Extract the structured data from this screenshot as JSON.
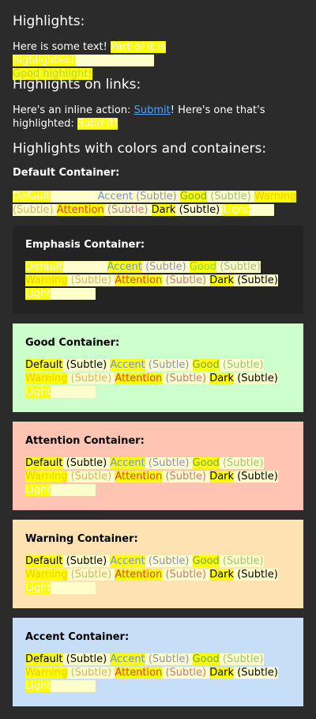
{
  "sections": {
    "highlights_title": "Highlights:",
    "highlights_text_plain": "Here is some text! ",
    "highlights_text_hl": "Part of it is highlighted!",
    "highlights_text_space": " ",
    "highlights_text_hl2": "Good highlight!",
    "links_title": "Highlights on links:",
    "links_text_plain": "Here's an inline action: ",
    "links_action1": "Submit",
    "links_text_mid": "! Here's one that's highlighted: ",
    "links_action2": "Submit!",
    "colors_title": "Highlights with colors and containers:"
  },
  "labels": {
    "default": "Default",
    "subtle": "(Subtle)",
    "accent": "Accent",
    "good": "Good",
    "warning": "Warning",
    "attention": "Attention",
    "dark": "Dark",
    "light": "Light"
  },
  "containers": [
    {
      "title": "Default Container:",
      "bg": "#2b2b2b"
    },
    {
      "title": "Emphasis Container:",
      "bg": "#232323"
    },
    {
      "title": "Good Container:",
      "bg": "#ccffcc"
    },
    {
      "title": "Attention Container:",
      "bg": "#ffc5b2"
    },
    {
      "title": "Warning Container:",
      "bg": "#ffe2b2"
    },
    {
      "title": "Accent Container:",
      "bg": "#c7def9"
    }
  ],
  "colors": {
    "highlight": "#ffff00",
    "highlight_light": "#ffffcc",
    "text_default": "#ffffff",
    "accent": "#6e8fe6",
    "accent_subtle": "#8a8fbf",
    "good": "#8fd14f",
    "good_subtle": "#9cc27a",
    "warning": "#f5c518",
    "warning_subtle": "#d8b26a",
    "attention": "#e53935",
    "attention_subtle": "#c47a7a",
    "dark": "#000000",
    "light": "#ffffff"
  }
}
